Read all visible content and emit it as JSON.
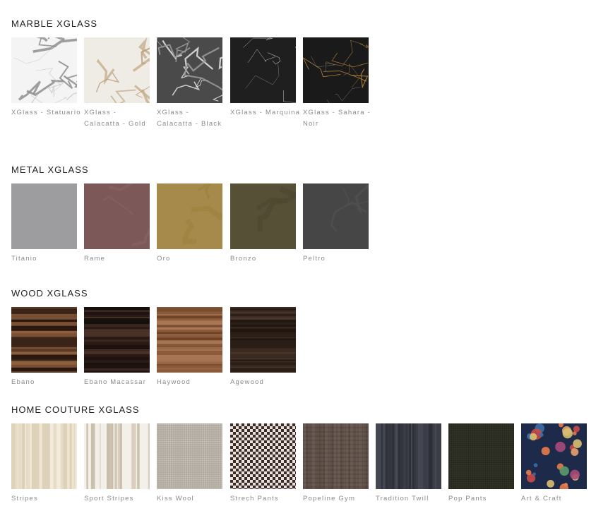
{
  "sections": [
    {
      "title": "MARBLE XGLASS",
      "items": [
        {
          "label": "XGlass - Statuario",
          "style": "statuario"
        },
        {
          "label": "XGlass - Calacatta - Gold",
          "style": "calacatta-gold"
        },
        {
          "label": "XGlass - Calacatta - Black",
          "style": "calacatta-black"
        },
        {
          "label": "XGlass - Marquina",
          "style": "marquina"
        },
        {
          "label": "XGlass - Sahara - Noir",
          "style": "sahara-noir"
        }
      ]
    },
    {
      "title": "METAL XGLASS",
      "items": [
        {
          "label": "Titanio",
          "style": "titanio"
        },
        {
          "label": "Rame",
          "style": "rame"
        },
        {
          "label": "Oro",
          "style": "oro"
        },
        {
          "label": "Bronzo",
          "style": "bronzo"
        },
        {
          "label": "Peltro",
          "style": "peltro"
        }
      ]
    },
    {
      "title": "WOOD XGLASS",
      "items": [
        {
          "label": "Ebano",
          "style": "ebano"
        },
        {
          "label": "Ebano Macassar",
          "style": "macassar"
        },
        {
          "label": "Haywood",
          "style": "haywood"
        },
        {
          "label": "Agewood",
          "style": "agewood"
        }
      ]
    },
    {
      "title": "HOME COUTURE XGLASS",
      "items": [
        {
          "label": "Stripes",
          "style": "stripes"
        },
        {
          "label": "Sport Stripes",
          "style": "sport-stripes"
        },
        {
          "label": "Kiss Wool",
          "style": "kiss-wool"
        },
        {
          "label": "Strech Pants",
          "style": "strech-pants"
        },
        {
          "label": "Popeline Gym",
          "style": "popeline-gym"
        },
        {
          "label": "Tradition Twill",
          "style": "tradition-twill"
        },
        {
          "label": "Pop Pants",
          "style": "pop-pants"
        },
        {
          "label": "Art & Craft",
          "style": "art-craft"
        }
      ]
    }
  ]
}
